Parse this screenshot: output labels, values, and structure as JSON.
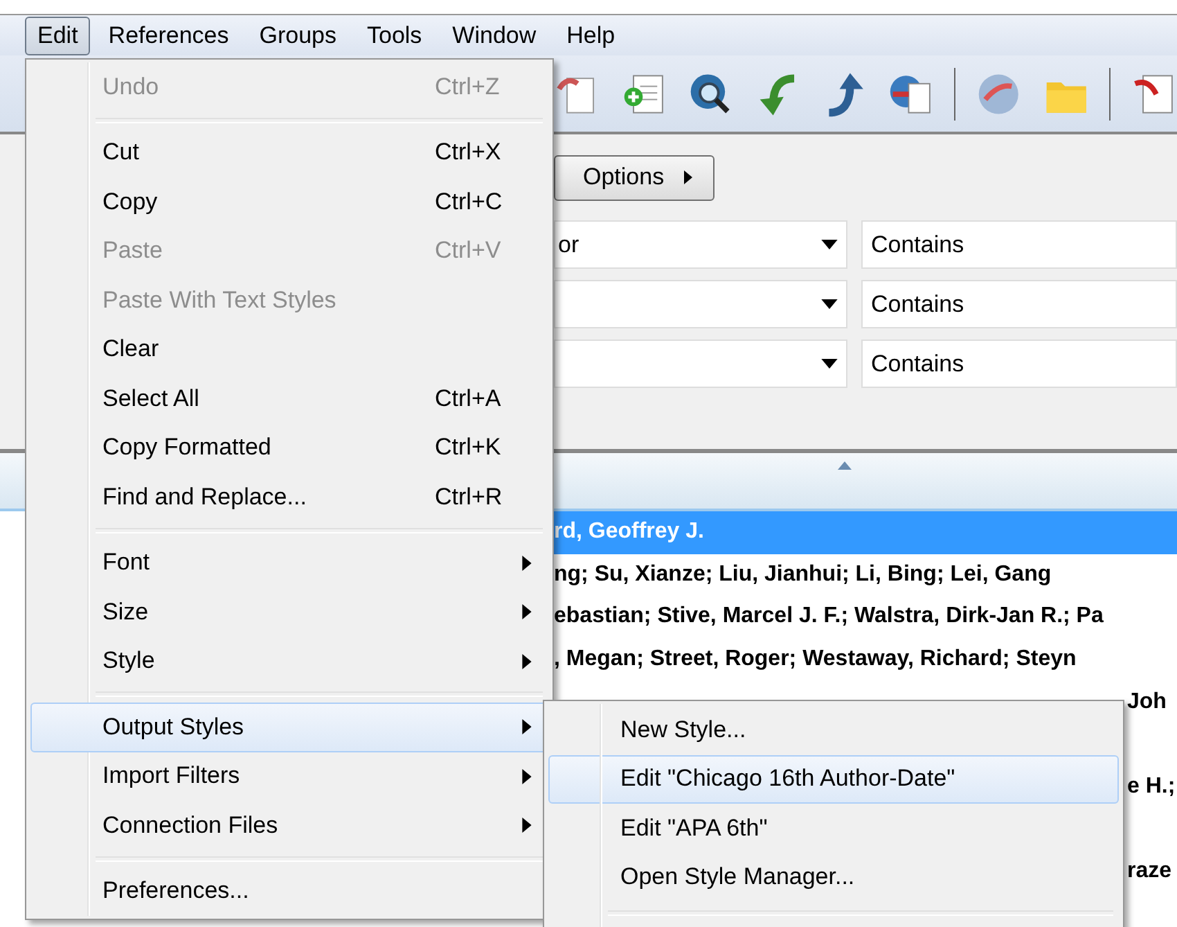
{
  "menubar": [
    {
      "label": "Edit",
      "selected": true
    },
    {
      "label": "References",
      "selected": false
    },
    {
      "label": "Groups",
      "selected": false
    },
    {
      "label": "Tools",
      "selected": false
    },
    {
      "label": "Window",
      "selected": false
    },
    {
      "label": "Help",
      "selected": false
    }
  ],
  "options_button": {
    "label": "Options"
  },
  "search_rows": [
    {
      "field": "or",
      "operator": "Contains"
    },
    {
      "operator": "Contains"
    },
    {
      "operator": "Contains"
    }
  ],
  "reference_list": {
    "rows": [
      {
        "kind": "visible",
        "text": "rd, Geoffrey J.",
        "selected": true
      },
      {
        "kind": "visible",
        "text": "ng; Su, Xianze; Liu, Jianhui; Li, Bing; Lei, Gang",
        "selected": false
      },
      {
        "kind": "visible",
        "text": "ebastian; Stive, Marcel J. F.; Walstra, Dirk-Jan R.; Pa",
        "selected": false
      },
      {
        "kind": "visible",
        "text": ", Megan; Street, Roger; Westaway, Richard; Steyn",
        "selected": false
      },
      {
        "kind": "covered",
        "text": "Joh",
        "selected": false
      },
      {
        "kind": "covered",
        "text": "e H.;",
        "selected": false
      },
      {
        "kind": "covered",
        "text": "raze",
        "selected": false
      }
    ]
  },
  "edit_menu": {
    "items": [
      {
        "kind": "item",
        "label": "Undo",
        "shortcut": "Ctrl+Z",
        "disabled": true,
        "selected": false
      },
      {
        "kind": "separator"
      },
      {
        "kind": "item",
        "label": "Cut",
        "shortcut": "Ctrl+X",
        "disabled": false,
        "selected": false
      },
      {
        "kind": "item",
        "label": "Copy",
        "shortcut": "Ctrl+C",
        "disabled": false,
        "selected": false
      },
      {
        "kind": "item",
        "label": "Paste",
        "shortcut": "Ctrl+V",
        "disabled": true,
        "selected": false
      },
      {
        "kind": "item",
        "label": "Paste With Text Styles",
        "disabled": true,
        "selected": false
      },
      {
        "kind": "item",
        "label": "Clear",
        "disabled": false,
        "selected": false
      },
      {
        "kind": "item",
        "label": "Select All",
        "shortcut": "Ctrl+A",
        "disabled": false,
        "selected": false
      },
      {
        "kind": "item",
        "label": "Copy Formatted",
        "shortcut": "Ctrl+K",
        "disabled": false,
        "selected": false
      },
      {
        "kind": "item",
        "label": "Find and Replace...",
        "shortcut": "Ctrl+R",
        "disabled": false,
        "selected": false
      },
      {
        "kind": "separator"
      },
      {
        "kind": "submenu",
        "label": "Font",
        "disabled": false,
        "selected": false
      },
      {
        "kind": "submenu",
        "label": "Size",
        "disabled": false,
        "selected": false
      },
      {
        "kind": "submenu",
        "label": "Style",
        "disabled": false,
        "selected": false
      },
      {
        "kind": "separator"
      },
      {
        "kind": "submenu",
        "label": "Output Styles",
        "disabled": false,
        "selected": true
      },
      {
        "kind": "submenu",
        "label": "Import Filters",
        "disabled": false,
        "selected": false
      },
      {
        "kind": "submenu",
        "label": "Connection Files",
        "disabled": false,
        "selected": false
      },
      {
        "kind": "separator"
      },
      {
        "kind": "item",
        "label": "Preferences...",
        "disabled": false,
        "selected": false
      }
    ]
  },
  "output_styles_submenu": {
    "items": [
      {
        "kind": "item",
        "label": "New Style...",
        "selected": false
      },
      {
        "kind": "item",
        "label": "Edit \"Chicago 16th Author-Date\"",
        "selected": true
      },
      {
        "kind": "item",
        "label": "Edit \"APA 6th\"",
        "selected": false
      },
      {
        "kind": "item",
        "label": "Open Style Manager...",
        "selected": false
      },
      {
        "kind": "separator"
      }
    ]
  }
}
